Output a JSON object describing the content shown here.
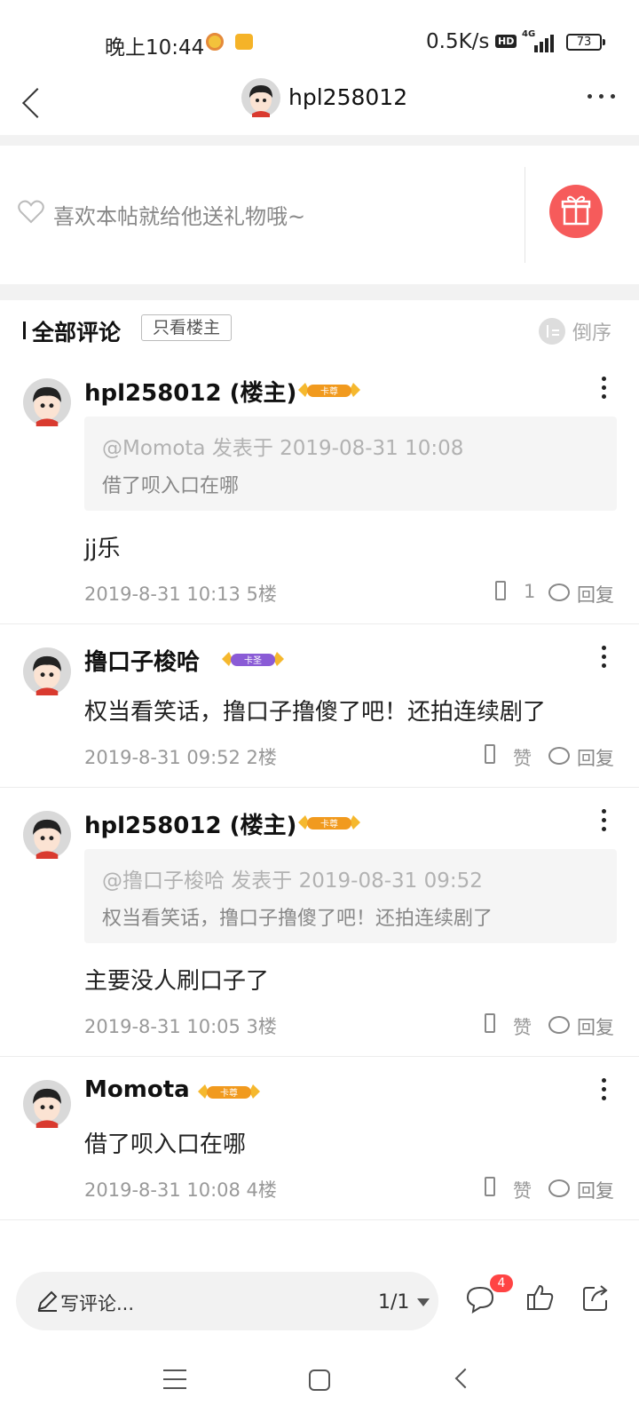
{
  "status_bar": {
    "time": "晚上10:44",
    "network_speed": "0.5K/s",
    "hd_label": "HD",
    "signal_label": "4G",
    "battery": "73"
  },
  "header": {
    "title": "hpl258012",
    "avatar_icon": "cartoon-avatar",
    "back_icon": "chevron-left",
    "more_icon": "more-horizontal"
  },
  "gift_bar": {
    "heart_icon": "heart-outline",
    "text": "喜欢本帖就给他送礼物哦~",
    "gift_icon": "gift",
    "gift_color": "#f65b5b"
  },
  "comments_header": {
    "title": "全部评论",
    "filter_label": "只看楼主",
    "sort_label": "倒序",
    "sort_icon": "sort"
  },
  "comments": [
    {
      "author": "hpl258012 (楼主)",
      "badge": "卡尊",
      "quote_header": "@Momota 发表于 2019-08-31 10:08",
      "quote_text": "借了呗入口在哪",
      "body": "jj乐",
      "meta": "2019-8-31 10:13  5楼",
      "like_label": "1",
      "reply_label": "回复"
    },
    {
      "author": "撸口子梭哈",
      "badge": "卡圣",
      "body": "权当看笑话，撸口子撸傻了吧！还拍连续剧了",
      "meta": "2019-8-31 09:52  2楼",
      "like_label": "赞",
      "reply_label": "回复"
    },
    {
      "author": "hpl258012 (楼主)",
      "badge": "卡尊",
      "quote_header": "@撸口子梭哈 发表于 2019-08-31 09:52",
      "quote_text": "权当看笑话，撸口子撸傻了吧！还拍连续剧了",
      "body": "主要没人刷口子了",
      "meta": "2019-8-31 10:05  3楼",
      "like_label": "赞",
      "reply_label": "回复"
    },
    {
      "author": "Momota",
      "badge": "卡尊",
      "body": "借了呗入口在哪",
      "meta": "2019-8-31 10:08  4楼",
      "like_label": "赞",
      "reply_label": "回复"
    }
  ],
  "bottom_bar": {
    "write_placeholder": "写评论...",
    "page": "1/1",
    "comment_count": "4",
    "icons": [
      "pencil",
      "caret-down",
      "comment",
      "thumb-up",
      "share"
    ]
  },
  "nav_bar": {
    "icons": [
      "menu",
      "home",
      "back"
    ]
  },
  "colors": {
    "accent_red": "#f65b5b",
    "badge_gold": "#f5b82e",
    "badge_purple": "#8a5bd6",
    "divider_gray": "#f2f2f2"
  }
}
